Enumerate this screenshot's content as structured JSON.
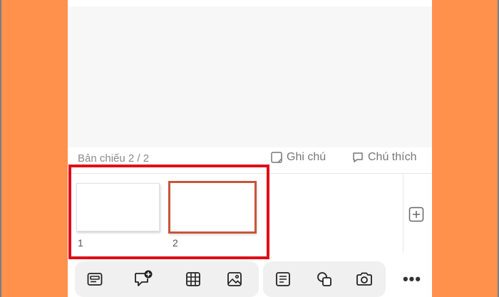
{
  "status_bar": {
    "slide_counter": "Bản chiếu 2 / 2",
    "notes_label": "Ghi chú",
    "comments_label": "Chú thích"
  },
  "thumbnails": [
    {
      "number": "1",
      "selected": false
    },
    {
      "number": "2",
      "selected": true
    }
  ],
  "toolbar": {
    "items": [
      {
        "icon": "layout-icon"
      },
      {
        "icon": "add-comment-icon"
      },
      {
        "icon": "table-icon"
      },
      {
        "icon": "image-icon"
      },
      {
        "icon": "text-box-icon"
      },
      {
        "icon": "shapes-icon"
      },
      {
        "icon": "camera-icon"
      }
    ],
    "more_label": "•••"
  },
  "colors": {
    "side_background": "#ff914d",
    "selected_thumb_border": "#c8553d",
    "highlight": "#e10b17"
  }
}
